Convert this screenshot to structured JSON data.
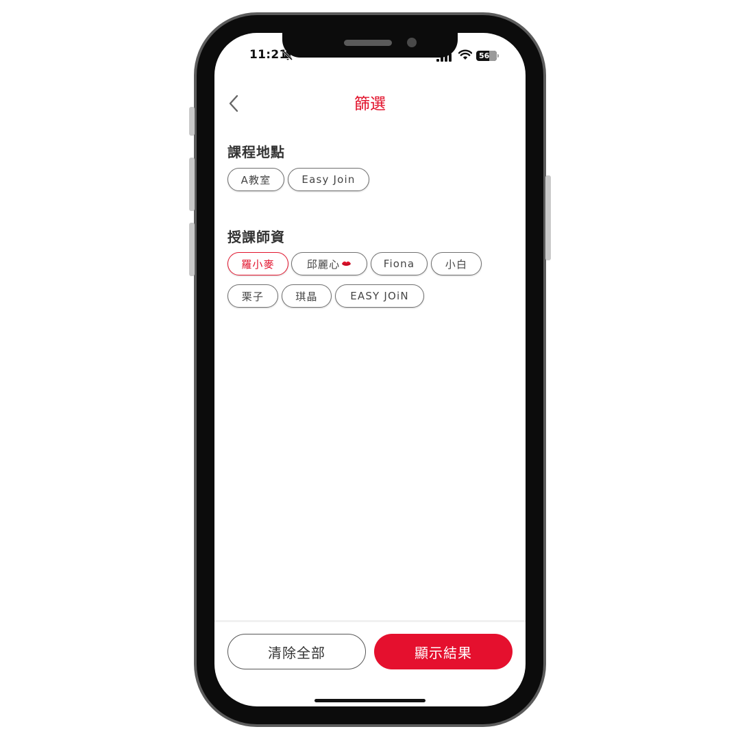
{
  "status_bar": {
    "time": "11:21",
    "battery": "56",
    "bell_icon": "bell-slash-icon",
    "signal_icon": "cellular-signal-icon",
    "wifi_icon": "wifi-icon"
  },
  "header": {
    "back_icon": "chevron-left-icon",
    "title": "篩選"
  },
  "sections": [
    {
      "title": "課程地點",
      "options": [
        {
          "label": "A教室",
          "selected": false
        },
        {
          "label": "Easy Join",
          "selected": false
        }
      ]
    },
    {
      "title": "授課師資",
      "options": [
        {
          "label": "羅小麥",
          "selected": true
        },
        {
          "label": "邱麗心",
          "selected": false,
          "icon": "lips-emoji-icon"
        },
        {
          "label": "Fiona",
          "selected": false
        },
        {
          "label": "小白",
          "selected": false
        },
        {
          "label": "栗子",
          "selected": false
        },
        {
          "label": "琪晶",
          "selected": false
        },
        {
          "label": "EASY JOiN",
          "selected": false
        }
      ]
    }
  ],
  "footer": {
    "clear_label": "清除全部",
    "show_label": "顯示結果"
  },
  "colors": {
    "accent": "#e2132c",
    "button_primary": "#e5102e",
    "text": "#333333",
    "chip_border": "#6f6f6f"
  }
}
